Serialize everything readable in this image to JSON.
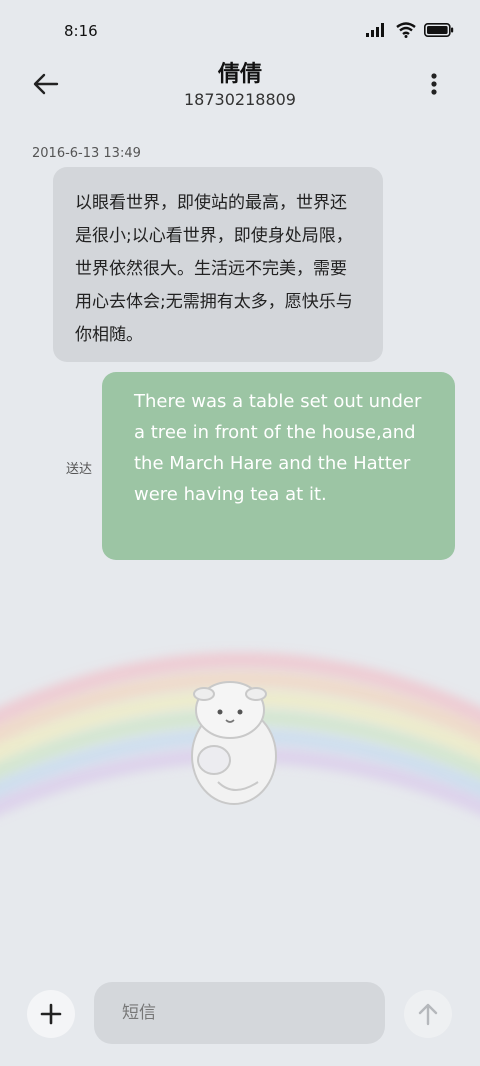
{
  "status_bar": {
    "time": "8:16",
    "icons": [
      "signal-icon",
      "wifi-icon",
      "battery-icon"
    ]
  },
  "header": {
    "contact_name": "倩倩",
    "contact_number": "18730218809",
    "back_icon": "back-arrow-icon",
    "more_icon": "more-vert-icon"
  },
  "conversation": {
    "timestamp": "2016-6-13 13:49",
    "incoming_message": "以眼看世界，即使站的最高，世界还是很小;以心看世界，即使身处局限，世界依然很大。生活远不完美，需要用心去体会;无需拥有太多，愿快乐与你相随。",
    "outgoing_message": "There was a table set out under a tree in front of the house,and the March Hare and the Hatter were having tea at it.",
    "outgoing_status": "送达"
  },
  "composer": {
    "placeholder": "短信",
    "add_icon": "plus-icon",
    "send_icon": "send-arrow-up-icon"
  },
  "colors": {
    "background": "#e6e9ed",
    "incoming_bubble": "#d3d6da",
    "outgoing_bubble": "#9cc5a4",
    "input_field": "#d4d7db"
  }
}
